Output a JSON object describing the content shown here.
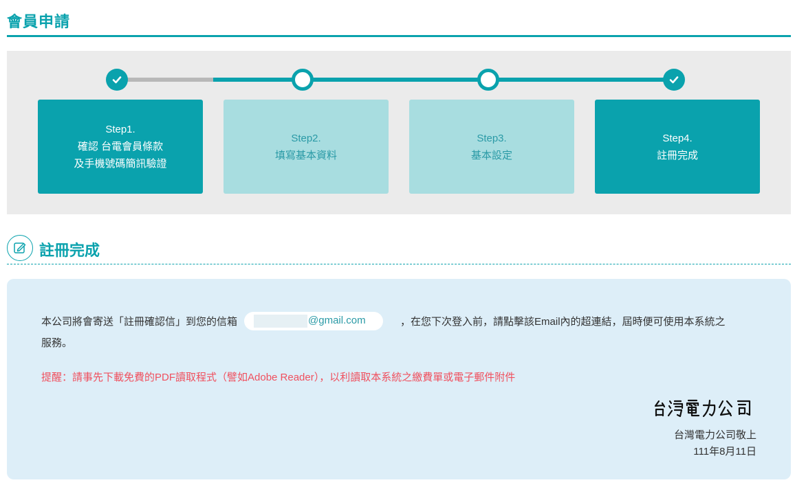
{
  "page": {
    "title": "會員申請"
  },
  "steps": [
    {
      "lines": [
        "Step1.",
        "確認 台電會員條款",
        "及手機號碼簡訊驗證"
      ],
      "state": "active"
    },
    {
      "lines": [
        "Step2.",
        "填寫基本資料"
      ],
      "state": "inactive"
    },
    {
      "lines": [
        "Step3.",
        "基本設定"
      ],
      "state": "inactive"
    },
    {
      "lines": [
        "Step4.",
        "註冊完成"
      ],
      "state": "active"
    }
  ],
  "section": {
    "title": "註冊完成",
    "icon": "edit-icon"
  },
  "notice": {
    "text_before_email": "本公司將會寄送「註冊確認信」到您的信箱",
    "email_domain": "@gmail.com",
    "text_after_email": "，在您下次登入前，請點擊該Email內的超連結，屆時便可使用本系統之",
    "text_line2": "服務。",
    "reminder": "提醒：請事先下載免費的PDF讀取程式（譬如Adobe Reader），以利讀取本系統之繳費單或電子郵件附件",
    "signature_image": "台灣電力公司",
    "sign_off": "台灣電力公司敬上",
    "date": "111年8月11日"
  },
  "colors": {
    "accent": "#0aa2ad",
    "step_inactive_bg": "#a8dde0",
    "panel_bg": "#ebebeb",
    "notice_bg": "#ddeef8",
    "reminder": "#f0505e"
  }
}
